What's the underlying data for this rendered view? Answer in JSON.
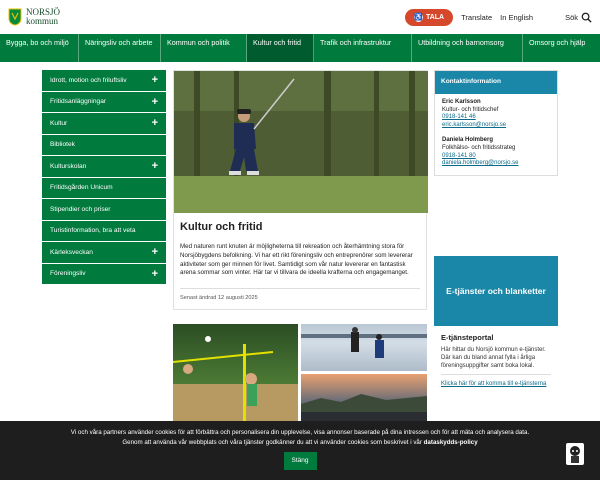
{
  "header": {
    "logo_text_line1": "NORSJÖ",
    "logo_text_line2": "kommun",
    "tala_label": "TALA",
    "translate_label": "Translate",
    "english_label": "In English",
    "search_label": "Sök"
  },
  "mainnav": [
    {
      "label": "Bygga, bo och miljö"
    },
    {
      "label": "Näringsliv och arbete"
    },
    {
      "label": "Kommun och politik"
    },
    {
      "label": "Kultur och fritid"
    },
    {
      "label": "Trafik och infrastruktur"
    },
    {
      "label": "Utbildning och barnomsorg"
    },
    {
      "label": "Omsorg och hjälp"
    }
  ],
  "sidenav": [
    {
      "label": "Idrott, motion och friluftsliv",
      "expand": "+"
    },
    {
      "label": "Fritidsanläggningar",
      "expand": "+"
    },
    {
      "label": "Kultur",
      "expand": "+"
    },
    {
      "label": "Bibliotek",
      "expand": ""
    },
    {
      "label": "Kulturskolan",
      "expand": "+"
    },
    {
      "label": "Fritidsgården Unicum",
      "expand": ""
    },
    {
      "label": "Stipendier och priser",
      "expand": ""
    },
    {
      "label": "Turistinformation, bra att veta",
      "expand": ""
    },
    {
      "label": "Kärleksveckan",
      "expand": "+"
    },
    {
      "label": "Föreningsliv",
      "expand": "+"
    }
  ],
  "article": {
    "title": "Kultur och fritid",
    "body": "Med naturen runt knuten är möjligheterna till rekreation och återhämtning stora för Norsjöbygdens befolkning. Vi har ett rikt föreningsliv och entreprenörer som levererar aktiviteter som ger minnen för livet. Samtidigt som vår natur levererar en fantastisk arena sommar som vinter. Här tar vi tillvara de ideella krafterna och engagemanget.",
    "updated": "Senast ändrad 12 augusti 2025"
  },
  "contact": {
    "heading": "Kontaktinformation",
    "people": [
      {
        "name": "Eric Karlsson",
        "role": "Kultur- och fritidschef",
        "phone": "0918-141 46",
        "email": "eric.karlsson@norsjo.se"
      },
      {
        "name": "Daniela Holmberg",
        "role": "Folkhälso- och fritidsstrateg",
        "phone": "0918-141 80",
        "email": "daniela.holmberg@norsjo.se"
      }
    ]
  },
  "eservice": {
    "banner": "E-tjänster och blanketter",
    "title": "E-tjänsteportal",
    "text": "Här hittar du Norsjö kommun e-tjänster. Där kan du bland annat fylla i årliga föreningsuppgifter samt boka lokal.",
    "link": "Klicka här för att komma till e-tjänsterna"
  },
  "cookie": {
    "text": "Vi och våra partners använder cookies för att förbättra och personalisera din upplevelse, visa annonser baserade på dina intressen och för att mäta och analysera data. Genom att använda vår webbplats och våra tjänster godkänner du att vi använder cookies som beskrivet i vår",
    "policy_link": "dataskydds-policy",
    "close_label": "Stäng"
  },
  "colors": {
    "brand_green": "#007a3d",
    "accent_blue": "#1a87a8",
    "tala_red": "#d6482b"
  }
}
